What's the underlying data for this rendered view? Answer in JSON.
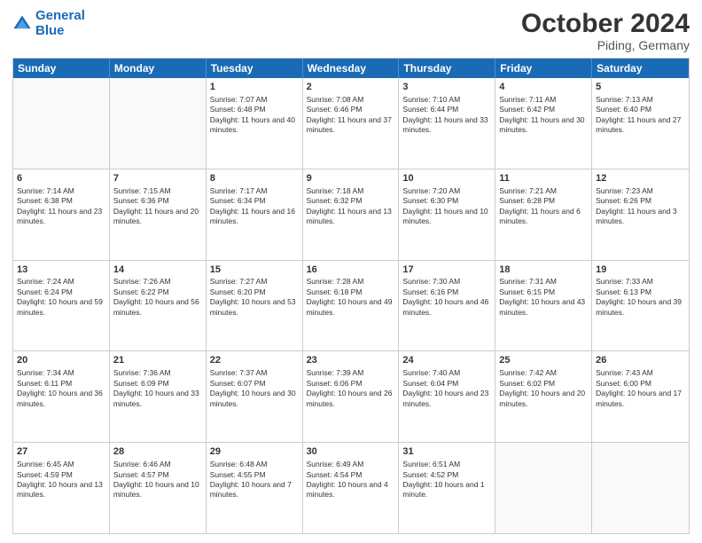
{
  "header": {
    "logo_line1": "General",
    "logo_line2": "Blue",
    "month_title": "October 2024",
    "subtitle": "Piding, Germany"
  },
  "weekdays": [
    "Sunday",
    "Monday",
    "Tuesday",
    "Wednesday",
    "Thursday",
    "Friday",
    "Saturday"
  ],
  "rows": [
    [
      {
        "day": "",
        "text": ""
      },
      {
        "day": "",
        "text": ""
      },
      {
        "day": "1",
        "text": "Sunrise: 7:07 AM\nSunset: 6:48 PM\nDaylight: 11 hours and 40 minutes."
      },
      {
        "day": "2",
        "text": "Sunrise: 7:08 AM\nSunset: 6:46 PM\nDaylight: 11 hours and 37 minutes."
      },
      {
        "day": "3",
        "text": "Sunrise: 7:10 AM\nSunset: 6:44 PM\nDaylight: 11 hours and 33 minutes."
      },
      {
        "day": "4",
        "text": "Sunrise: 7:11 AM\nSunset: 6:42 PM\nDaylight: 11 hours and 30 minutes."
      },
      {
        "day": "5",
        "text": "Sunrise: 7:13 AM\nSunset: 6:40 PM\nDaylight: 11 hours and 27 minutes."
      }
    ],
    [
      {
        "day": "6",
        "text": "Sunrise: 7:14 AM\nSunset: 6:38 PM\nDaylight: 11 hours and 23 minutes."
      },
      {
        "day": "7",
        "text": "Sunrise: 7:15 AM\nSunset: 6:36 PM\nDaylight: 11 hours and 20 minutes."
      },
      {
        "day": "8",
        "text": "Sunrise: 7:17 AM\nSunset: 6:34 PM\nDaylight: 11 hours and 16 minutes."
      },
      {
        "day": "9",
        "text": "Sunrise: 7:18 AM\nSunset: 6:32 PM\nDaylight: 11 hours and 13 minutes."
      },
      {
        "day": "10",
        "text": "Sunrise: 7:20 AM\nSunset: 6:30 PM\nDaylight: 11 hours and 10 minutes."
      },
      {
        "day": "11",
        "text": "Sunrise: 7:21 AM\nSunset: 6:28 PM\nDaylight: 11 hours and 6 minutes."
      },
      {
        "day": "12",
        "text": "Sunrise: 7:23 AM\nSunset: 6:26 PM\nDaylight: 11 hours and 3 minutes."
      }
    ],
    [
      {
        "day": "13",
        "text": "Sunrise: 7:24 AM\nSunset: 6:24 PM\nDaylight: 10 hours and 59 minutes."
      },
      {
        "day": "14",
        "text": "Sunrise: 7:26 AM\nSunset: 6:22 PM\nDaylight: 10 hours and 56 minutes."
      },
      {
        "day": "15",
        "text": "Sunrise: 7:27 AM\nSunset: 6:20 PM\nDaylight: 10 hours and 53 minutes."
      },
      {
        "day": "16",
        "text": "Sunrise: 7:28 AM\nSunset: 6:18 PM\nDaylight: 10 hours and 49 minutes."
      },
      {
        "day": "17",
        "text": "Sunrise: 7:30 AM\nSunset: 6:16 PM\nDaylight: 10 hours and 46 minutes."
      },
      {
        "day": "18",
        "text": "Sunrise: 7:31 AM\nSunset: 6:15 PM\nDaylight: 10 hours and 43 minutes."
      },
      {
        "day": "19",
        "text": "Sunrise: 7:33 AM\nSunset: 6:13 PM\nDaylight: 10 hours and 39 minutes."
      }
    ],
    [
      {
        "day": "20",
        "text": "Sunrise: 7:34 AM\nSunset: 6:11 PM\nDaylight: 10 hours and 36 minutes."
      },
      {
        "day": "21",
        "text": "Sunrise: 7:36 AM\nSunset: 6:09 PM\nDaylight: 10 hours and 33 minutes."
      },
      {
        "day": "22",
        "text": "Sunrise: 7:37 AM\nSunset: 6:07 PM\nDaylight: 10 hours and 30 minutes."
      },
      {
        "day": "23",
        "text": "Sunrise: 7:39 AM\nSunset: 6:06 PM\nDaylight: 10 hours and 26 minutes."
      },
      {
        "day": "24",
        "text": "Sunrise: 7:40 AM\nSunset: 6:04 PM\nDaylight: 10 hours and 23 minutes."
      },
      {
        "day": "25",
        "text": "Sunrise: 7:42 AM\nSunset: 6:02 PM\nDaylight: 10 hours and 20 minutes."
      },
      {
        "day": "26",
        "text": "Sunrise: 7:43 AM\nSunset: 6:00 PM\nDaylight: 10 hours and 17 minutes."
      }
    ],
    [
      {
        "day": "27",
        "text": "Sunrise: 6:45 AM\nSunset: 4:59 PM\nDaylight: 10 hours and 13 minutes."
      },
      {
        "day": "28",
        "text": "Sunrise: 6:46 AM\nSunset: 4:57 PM\nDaylight: 10 hours and 10 minutes."
      },
      {
        "day": "29",
        "text": "Sunrise: 6:48 AM\nSunset: 4:55 PM\nDaylight: 10 hours and 7 minutes."
      },
      {
        "day": "30",
        "text": "Sunrise: 6:49 AM\nSunset: 4:54 PM\nDaylight: 10 hours and 4 minutes."
      },
      {
        "day": "31",
        "text": "Sunrise: 6:51 AM\nSunset: 4:52 PM\nDaylight: 10 hours and 1 minute."
      },
      {
        "day": "",
        "text": ""
      },
      {
        "day": "",
        "text": ""
      }
    ]
  ]
}
